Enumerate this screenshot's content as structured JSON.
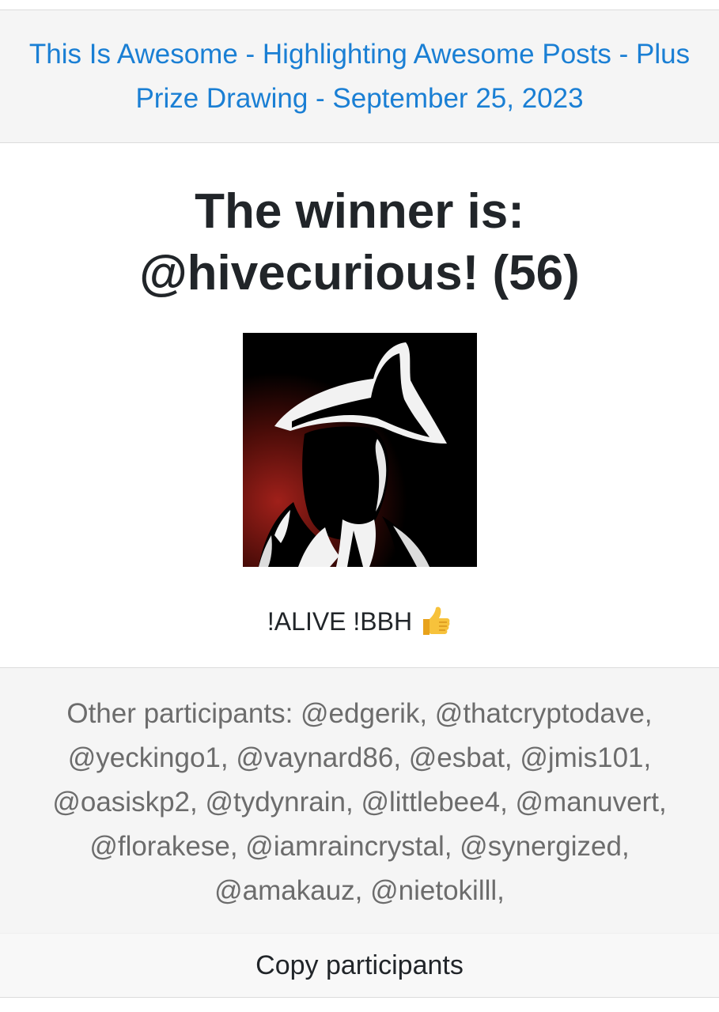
{
  "header": {
    "title_link": "This Is Awesome - Highlighting Awesome Posts - Plus Prize Drawing - September 25, 2023",
    "link_color": "#1a7fd4"
  },
  "winner": {
    "text": "The winner is: @hivecurious! (56)",
    "avatar_icon": "detective-silhouette-avatar"
  },
  "message": {
    "text": "!ALIVE !BBH",
    "emoji_icon": "thumbs-up-icon"
  },
  "participants": {
    "text": "Other participants: @edgerik, @thatcryptodave, @yeckingo1, @vaynard86, @esbat, @jmis101, @oasiskp2, @tydynrain, @littlebee4, @manuvert, @florakese, @iamraincrystal, @synergized, @amakauz, @nietokilll,"
  },
  "copy_button": {
    "label": "Copy participants"
  }
}
